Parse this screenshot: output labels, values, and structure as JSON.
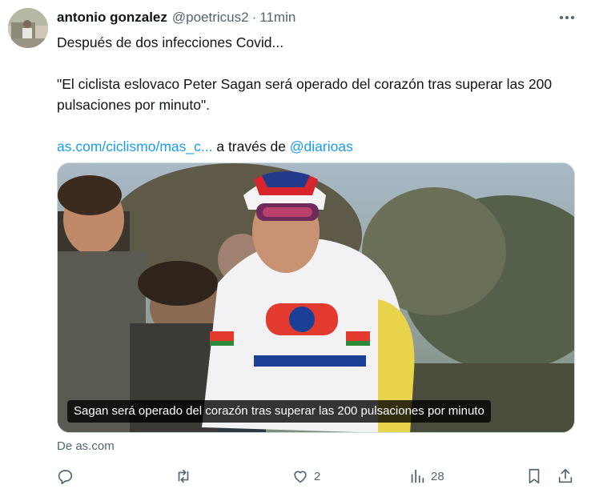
{
  "tweet": {
    "author_name": "antonio gonzalez",
    "handle": "@poetricus2",
    "separator": "·",
    "time": "11min",
    "text_line1": "Después de dos infecciones Covid...",
    "text_line2": "\"El ciclista eslovaco Peter Sagan será operado del corazón tras superar las 200 pulsaciones por minuto\".",
    "link_text": "as.com/ciclismo/mas_c...",
    "via_text": " a través de ",
    "mention": "@diarioas",
    "media_caption": "Sagan será operado del corazón tras superar las 200 pulsaciones por minuto",
    "source_label": "De as.com"
  },
  "actions": {
    "reply_count": "",
    "retweet_count": "",
    "like_count": "2",
    "views_count": "28"
  },
  "icons": {
    "more": "more-horizontal-icon",
    "reply": "reply-icon",
    "retweet": "retweet-icon",
    "like": "heart-icon",
    "views": "views-chart-icon",
    "bookmark": "bookmark-icon",
    "share": "share-icon"
  },
  "colors": {
    "link": "#1d9bf0",
    "text": "#0f1419",
    "secondary": "#536471",
    "border": "#cfd9de"
  }
}
